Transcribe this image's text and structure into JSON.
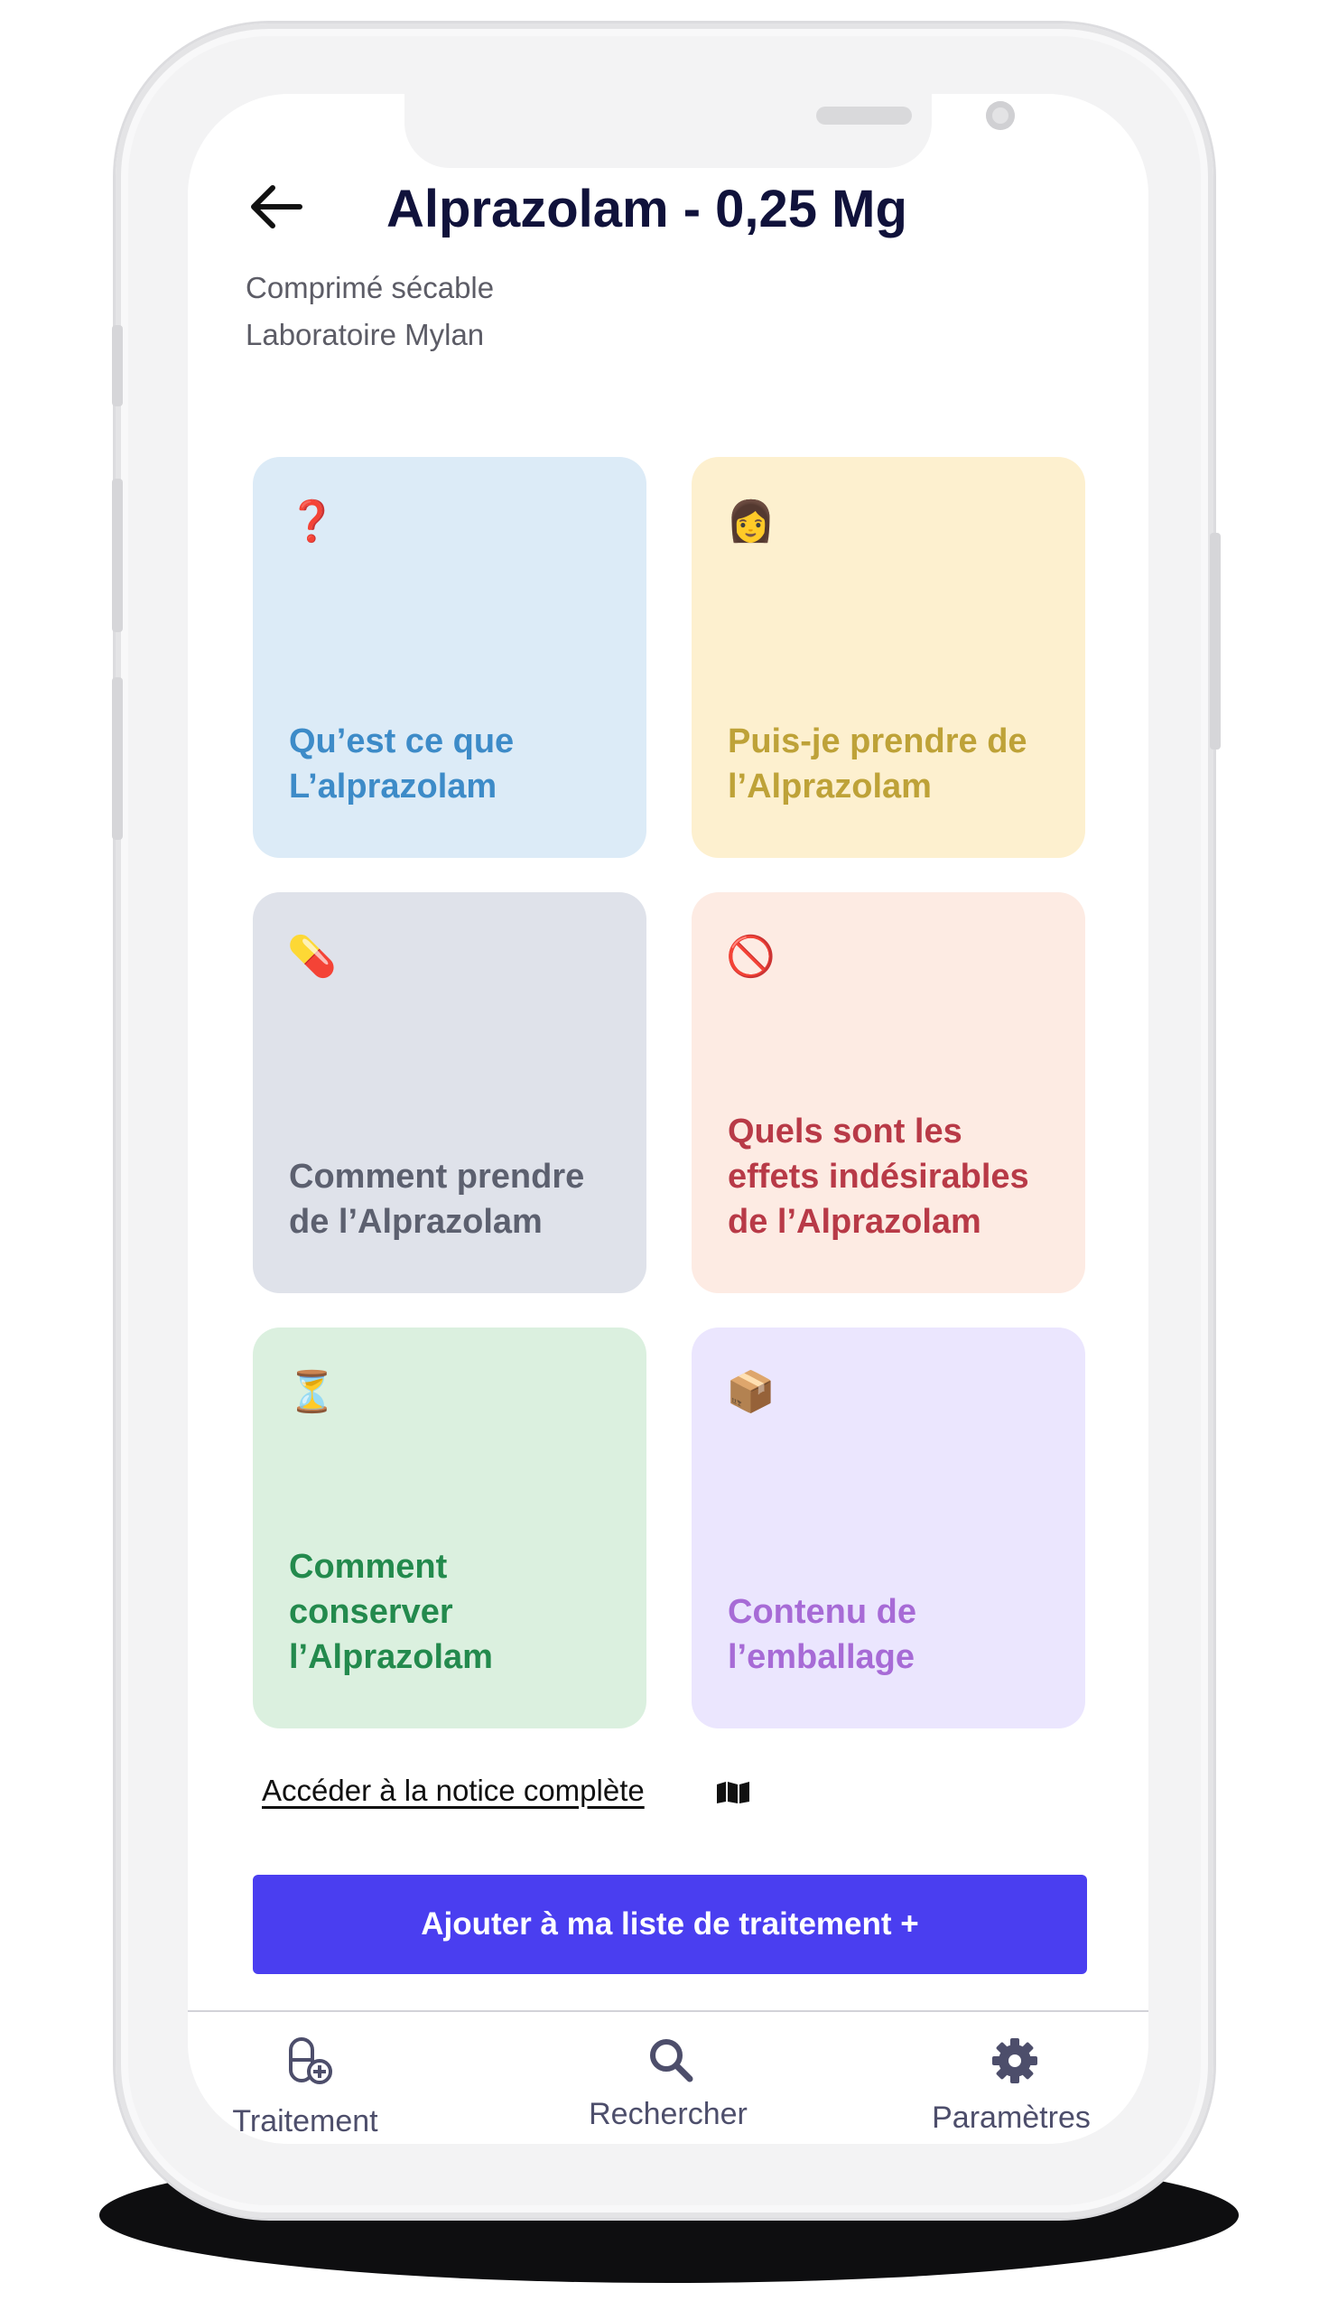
{
  "header": {
    "title": "Alprazolam - 0,25 Mg",
    "form": "Comprimé sécable",
    "lab": "Laboratoire Mylan"
  },
  "cards": [
    {
      "emoji": "❓",
      "label": "Qu’est ce que\nL’alprazolam",
      "bg": "#dcebf7",
      "color": "#3d8bc8",
      "icon": "question-icon"
    },
    {
      "emoji": "👩",
      "label": "Puis-je prendre de\nl’Alprazolam",
      "bg": "#fdf0cf",
      "color": "#bea238",
      "icon": "woman-icon"
    },
    {
      "emoji": "💊",
      "label": "Comment prendre\nde l’Alprazolam",
      "bg": "#dfe2ea",
      "color": "#5c606f",
      "icon": "pill-icon"
    },
    {
      "emoji": "🚫",
      "label": "Quels sont les\neffets indésirables\nde l’Alprazolam",
      "bg": "#fdebe3",
      "color": "#b83a47",
      "icon": "prohibited-icon"
    },
    {
      "emoji": "⏳",
      "label": "Comment\nconserver\nl’Alprazolam",
      "bg": "#dbf0df",
      "color": "#238a4d",
      "icon": "hourglass-icon"
    },
    {
      "emoji": "📦",
      "label": "Contenu de\nl’emballage",
      "bg": "#ebe6fe",
      "color": "#a76bd6",
      "icon": "package-icon"
    }
  ],
  "notice_link": "Accéder à la notice complète",
  "add_button": "Ajouter à ma liste de traitement +",
  "nav": [
    {
      "label": "Traitement",
      "icon": "pill-add-icon"
    },
    {
      "label": "Rechercher",
      "icon": "search-icon"
    },
    {
      "label": "Paramètres",
      "icon": "gear-icon"
    }
  ],
  "colors": {
    "title": "#10123b",
    "accent": "#4a3ef0",
    "nav": "#4d4e6b"
  }
}
